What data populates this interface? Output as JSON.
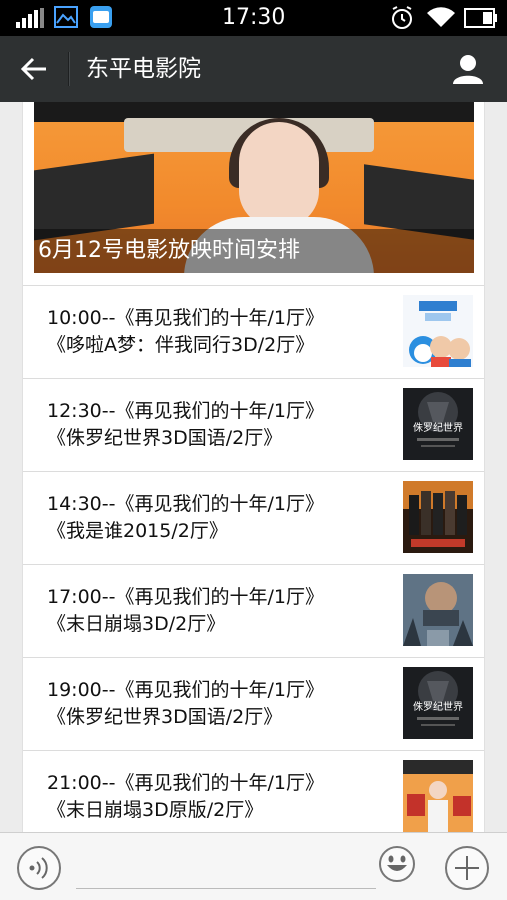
{
  "status": {
    "time": "17:30"
  },
  "header": {
    "title": "东平电影院"
  },
  "cover": {
    "caption": "6月12号电影放映时间安排"
  },
  "schedule": [
    {
      "line1": "10:00--《再见我们的十年/1厅》",
      "line2": "《哆啦A梦：伴我同行3D/2厅》",
      "thumb": "doraemon-poster"
    },
    {
      "line1": "12:30--《再见我们的十年/1厅》",
      "line2": "《侏罗纪世界3D国语/2厅》",
      "thumb": "jurassic-world-poster"
    },
    {
      "line1": "14:30--《再见我们的十年/1厅》",
      "line2": "《我是谁2015/2厅》",
      "thumb": "who-am-i-poster"
    },
    {
      "line1": "17:00--《再见我们的十年/1厅》",
      "line2": "《末日崩塌3D/2厅》",
      "thumb": "san-andreas-poster"
    },
    {
      "line1": "19:00--《再见我们的十年/1厅》",
      "line2": "《侏罗纪世界3D国语/2厅》",
      "thumb": "jurassic-world-poster"
    },
    {
      "line1": "21:00--《再见我们的十年/1厅》",
      "line2": "《末日崩塌3D原版/2厅》",
      "thumb": "ten-years-poster"
    }
  ],
  "poster_text": {
    "jurassic": "侏罗纪世界"
  },
  "colors": {
    "nav_bg": "#2e3132",
    "status_bg": "#000000",
    "cover_orange": "#f28a2c"
  }
}
